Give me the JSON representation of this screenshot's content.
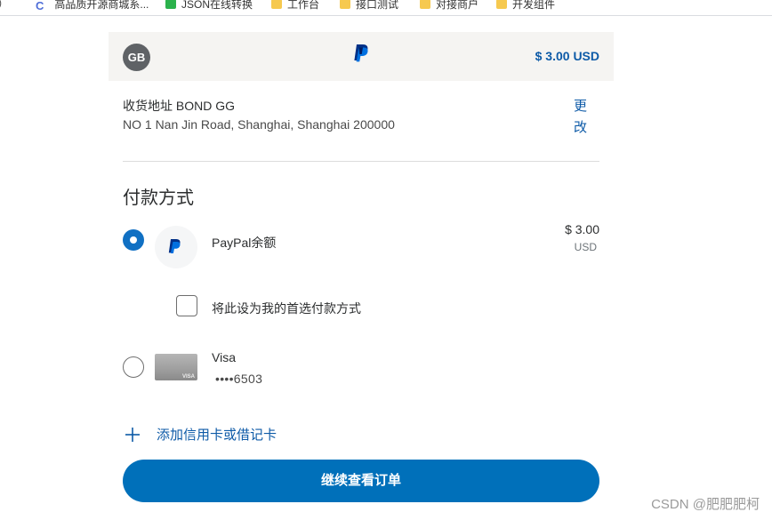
{
  "bookmarks": [
    {
      "label": "高品质开源商城系...",
      "icon": "c-icon"
    },
    {
      "label": "JSON在线转换",
      "icon": "green-icon"
    },
    {
      "label": "工作台",
      "icon": "folder-icon"
    },
    {
      "label": "接口测试",
      "icon": "folder-icon"
    },
    {
      "label": "对接商户",
      "icon": "folder-icon"
    },
    {
      "label": "开发组件",
      "icon": "folder-icon"
    }
  ],
  "header": {
    "avatar_initials": "GB",
    "logo": "paypal-logo",
    "amount": "$ 3.00 USD"
  },
  "shipping": {
    "label": "收货地址 BOND GG",
    "address": "NO 1 Nan Jin Road, Shanghai, Shanghai 200000",
    "change_label": "更改"
  },
  "payment": {
    "title": "付款方式",
    "options": [
      {
        "name": "PayPal余额",
        "amount": "$ 3.00",
        "currency": "USD",
        "selected": true,
        "icon": "paypal-icon"
      },
      {
        "name": "Visa",
        "number": "••••6503",
        "selected": false,
        "icon": "visa-card-icon",
        "card_brand": "VISA"
      }
    ],
    "preferred_label": "将此设为我的首选付款方式",
    "add_card_label": "添加信用卡或借记卡"
  },
  "continue_label": "继续查看订单",
  "watermark": "CSDN @肥肥肥柯",
  "colors": {
    "brand_blue": "#0070ba",
    "link_blue": "#0d5aa7",
    "radio_selected": "#1070c3",
    "header_bg": "#f5f4f2"
  }
}
